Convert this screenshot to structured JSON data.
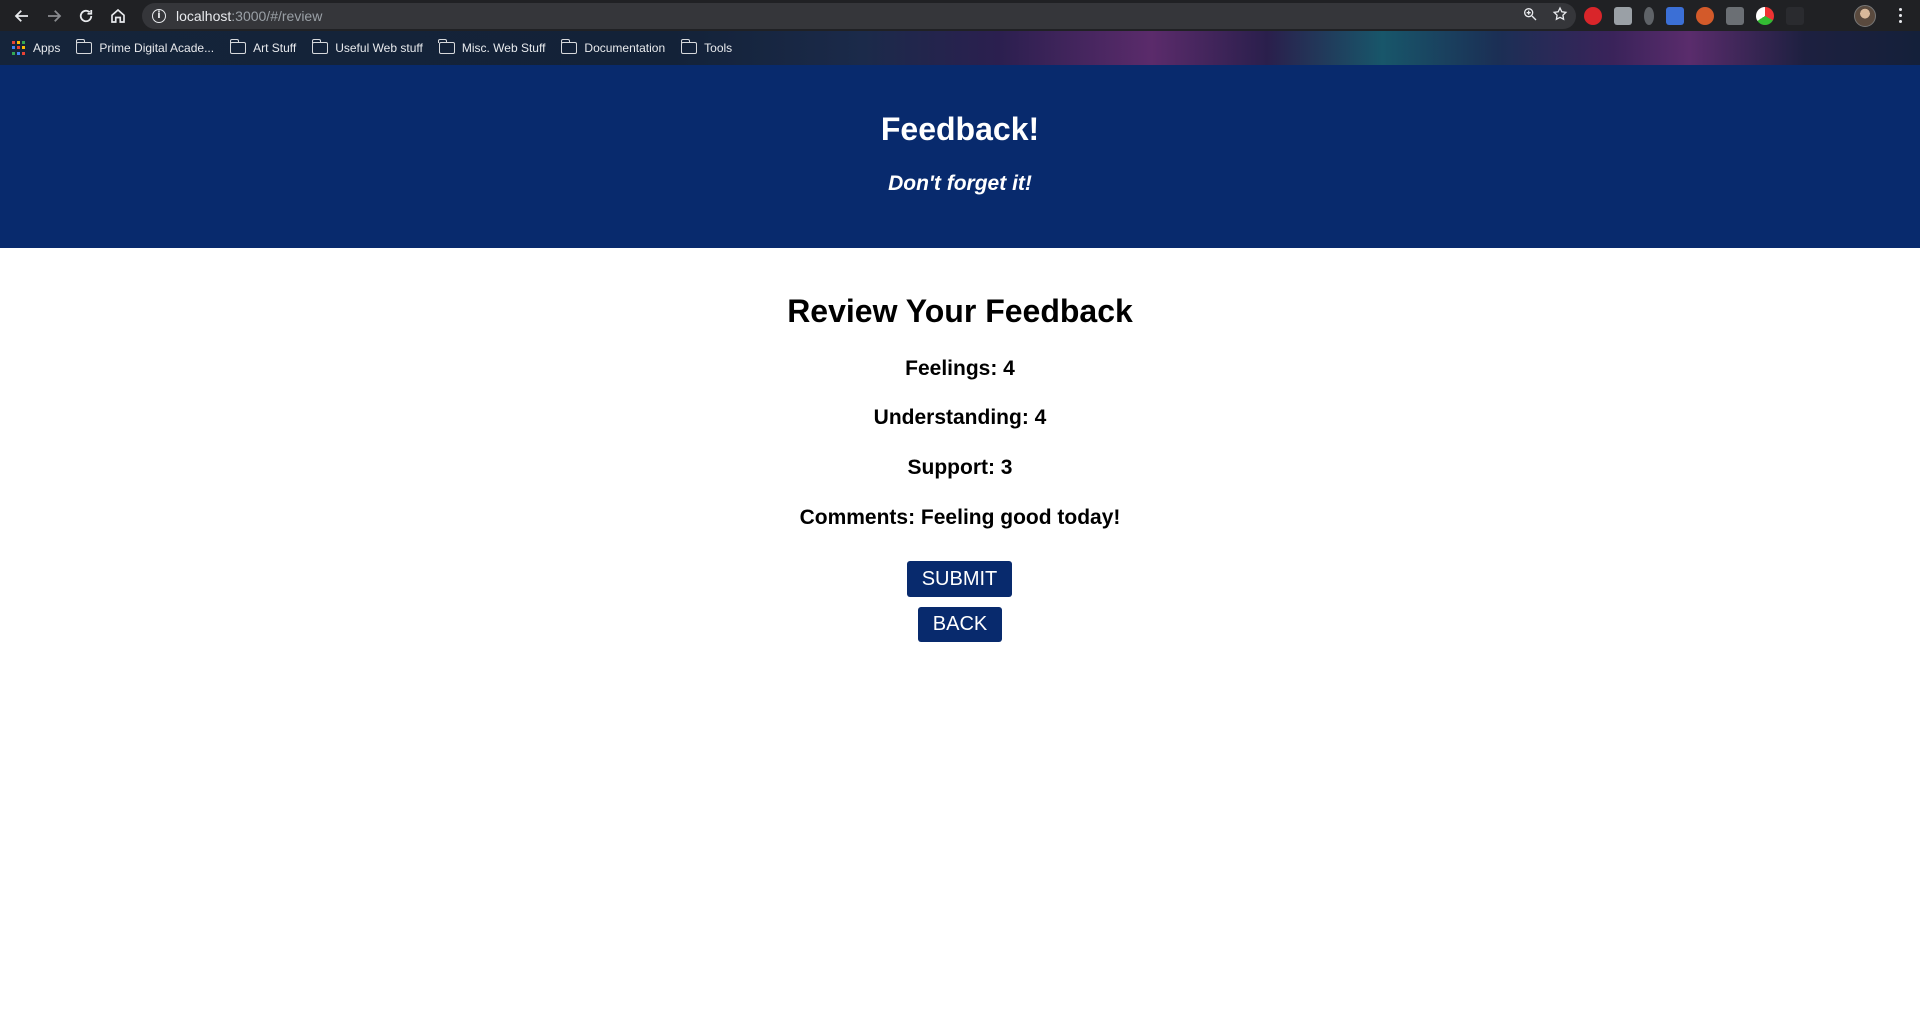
{
  "browser": {
    "url_host": "localhost",
    "url_path": ":3000/#/review",
    "bookmarks": [
      {
        "label": "Apps",
        "icon": "apps-grid-icon"
      },
      {
        "label": "Prime Digital Acade...",
        "icon": "folder-icon"
      },
      {
        "label": "Art Stuff",
        "icon": "folder-icon"
      },
      {
        "label": "Useful Web stuff",
        "icon": "folder-icon"
      },
      {
        "label": "Misc. Web Stuff",
        "icon": "folder-icon"
      },
      {
        "label": "Documentation",
        "icon": "folder-icon"
      },
      {
        "label": "Tools",
        "icon": "folder-icon"
      }
    ]
  },
  "header": {
    "title": "Feedback!",
    "subtitle": "Don't forget it!"
  },
  "review": {
    "heading": "Review Your Feedback",
    "feelings": "Feelings: 4",
    "understanding": "Understanding: 4",
    "support": "Support: 3",
    "comments": "Comments: Feeling good today!",
    "submit_label": "SUBMIT",
    "back_label": "BACK"
  },
  "colors": {
    "header_bg": "#082a6d",
    "button_bg": "#082a6d",
    "button_text": "#ffffff"
  }
}
